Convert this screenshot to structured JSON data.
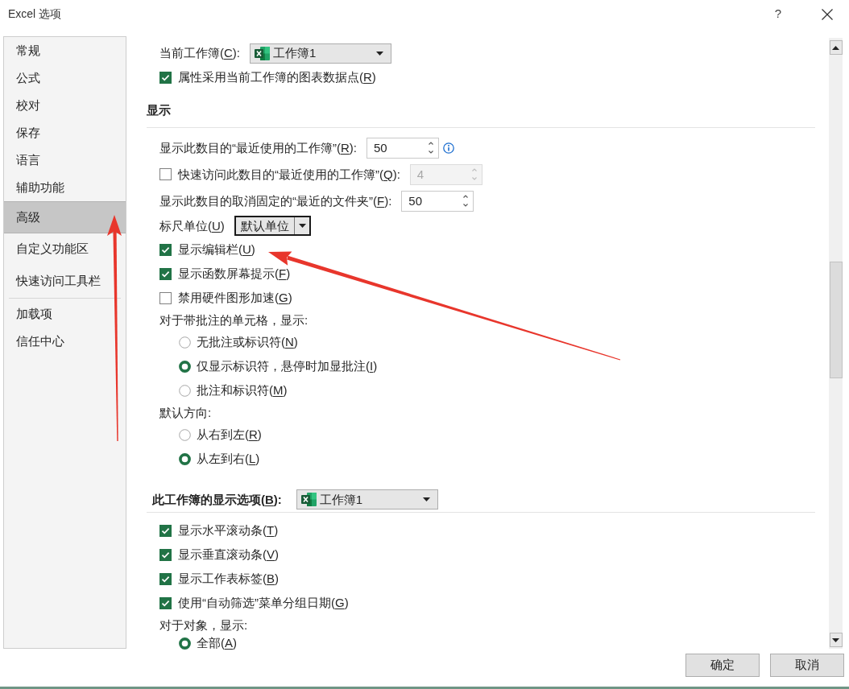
{
  "window": {
    "title": "Excel 选项",
    "help": "?"
  },
  "sidebar": {
    "groups": [
      {
        "items": [
          {
            "label": "常规",
            "selected": false
          },
          {
            "label": "公式",
            "selected": false
          },
          {
            "label": "校对",
            "selected": false
          },
          {
            "label": "保存",
            "selected": false
          },
          {
            "label": "语言",
            "selected": false
          },
          {
            "label": "辅助功能",
            "selected": false
          },
          {
            "label": "高级",
            "selected": true
          },
          {
            "label": "自定义功能区",
            "selected": false
          },
          {
            "label": "快速访问工具栏",
            "selected": false
          }
        ]
      },
      {
        "items": [
          {
            "label": "加载项",
            "selected": false
          },
          {
            "label": "信任中心",
            "selected": false
          }
        ]
      }
    ]
  },
  "content": {
    "rows": [
      {
        "kind": "workbook_select",
        "label": "当前工作簿(C):",
        "value": "工作簿1"
      },
      {
        "kind": "checkbox",
        "label": "属性采用当前工作簿的图表数据点(R)",
        "checked": true
      },
      {
        "kind": "section",
        "title": "显示"
      },
      {
        "kind": "spin",
        "label": "显示此数目的“最近使用的工作簿”(R):",
        "value": "50",
        "disabled": false,
        "info": true
      },
      {
        "kind": "checkbox_spin",
        "label": "快速访问此数目的“最近使用的工作簿”(Q):",
        "checked": false,
        "value": "4",
        "disabled": true
      },
      {
        "kind": "spin",
        "label": "显示此数目的取消固定的“最近的文件夹”(F):",
        "value": "50",
        "disabled": false
      },
      {
        "kind": "select",
        "label": "标尺单位(U)",
        "value": "默认单位",
        "focused": true
      },
      {
        "kind": "checkbox",
        "label": "显示编辑栏(U)",
        "checked": true
      },
      {
        "kind": "checkbox",
        "label": "显示函数屏幕提示(F)",
        "checked": true
      },
      {
        "kind": "checkbox",
        "label": "禁用硬件图形加速(G)",
        "checked": false
      },
      {
        "kind": "label",
        "text": "对于带批注的单元格，显示:"
      },
      {
        "kind": "radio",
        "label": "无批注或标识符(N)",
        "selected": false
      },
      {
        "kind": "radio",
        "label": "仅显示标识符，悬停时加显批注(I)",
        "selected": true
      },
      {
        "kind": "radio",
        "label": "批注和标识符(M)",
        "selected": false
      },
      {
        "kind": "label",
        "text": "默认方向:"
      },
      {
        "kind": "radio",
        "label": "从右到左(R)",
        "selected": false
      },
      {
        "kind": "radio",
        "label": "从左到右(L)",
        "selected": true
      },
      {
        "kind": "section_select",
        "title": "此工作簿的显示选项(B):",
        "value": "工作簿1"
      },
      {
        "kind": "checkbox",
        "label": "显示水平滚动条(T)",
        "checked": true
      },
      {
        "kind": "checkbox",
        "label": "显示垂直滚动条(V)",
        "checked": true
      },
      {
        "kind": "checkbox",
        "label": "显示工作表标签(B)",
        "checked": true
      },
      {
        "kind": "checkbox",
        "label": "使用“自动筛选”菜单分组日期(G)",
        "checked": true
      },
      {
        "kind": "label",
        "text": "对于对象，显示:"
      },
      {
        "kind": "radio",
        "label": "全部(A)",
        "selected": true
      }
    ]
  },
  "buttons": [
    "确定",
    "取消"
  ]
}
